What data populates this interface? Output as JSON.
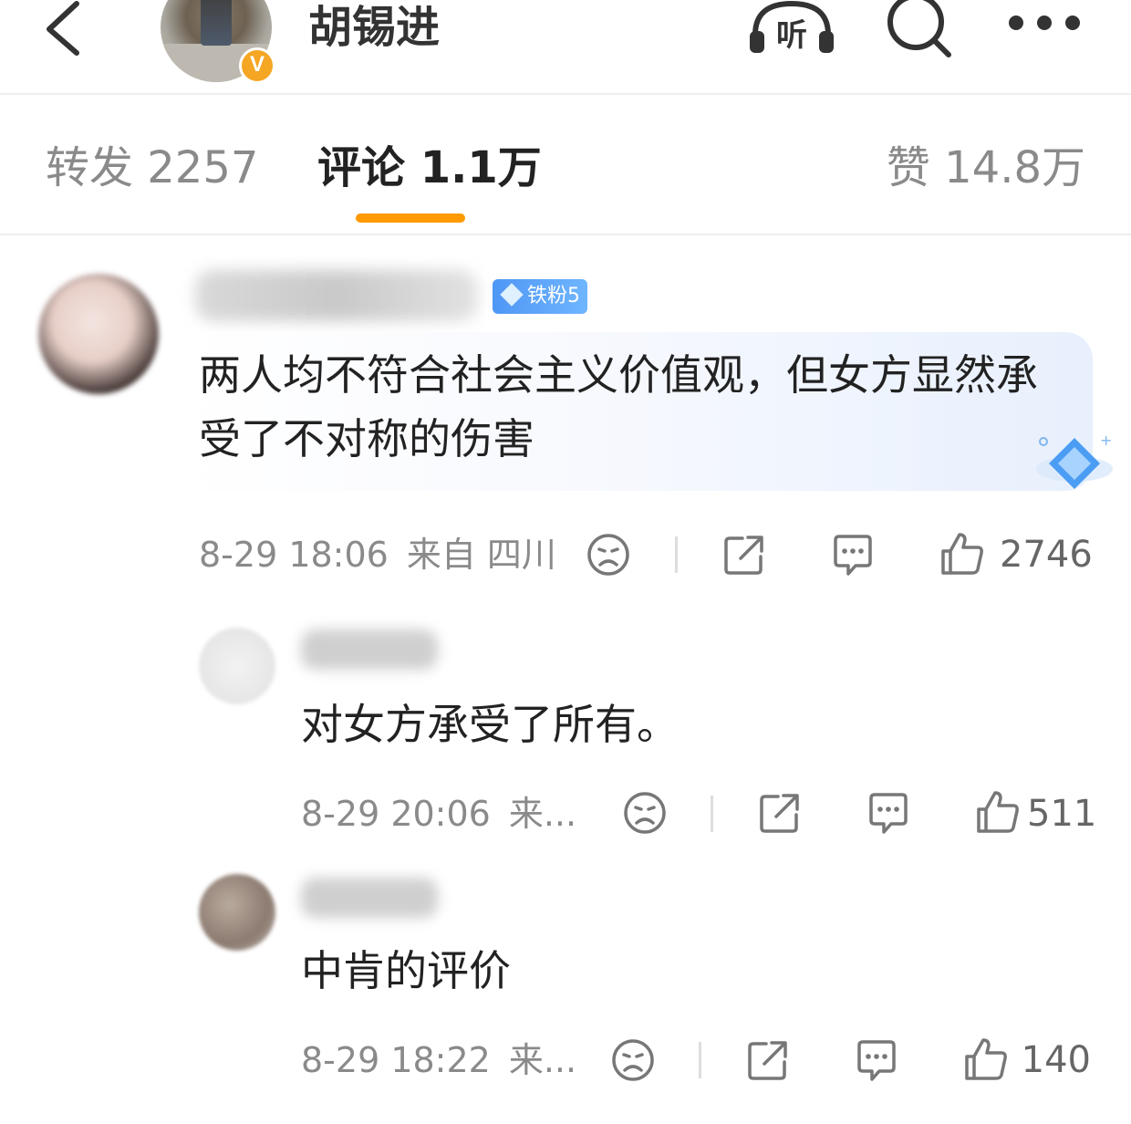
{
  "header": {
    "title": "胡锡进",
    "verified_badge": "V",
    "icons": [
      "back-icon",
      "listen-icon",
      "search-icon",
      "more-icon"
    ],
    "listen_label": "听"
  },
  "tabs": {
    "repost": "转发 2257",
    "comments": "评论 1.1万",
    "likes": "赞 14.8万",
    "active_color": "#ff9a00"
  },
  "comments": [
    {
      "fan_badge": "铁粉5",
      "text": "两人均不符合社会主义价值观，但女方显然承受了不对称的伤害",
      "time": "8-29 18:06",
      "location": "来自 四川",
      "likes": "2746"
    }
  ],
  "replies": [
    {
      "text": "对女方承受了所有。",
      "time": "8-29 20:06",
      "location": "来...",
      "likes": "511"
    },
    {
      "text": "中肯的评价",
      "time": "8-29 18:22",
      "location": "来...",
      "likes": "140"
    }
  ]
}
